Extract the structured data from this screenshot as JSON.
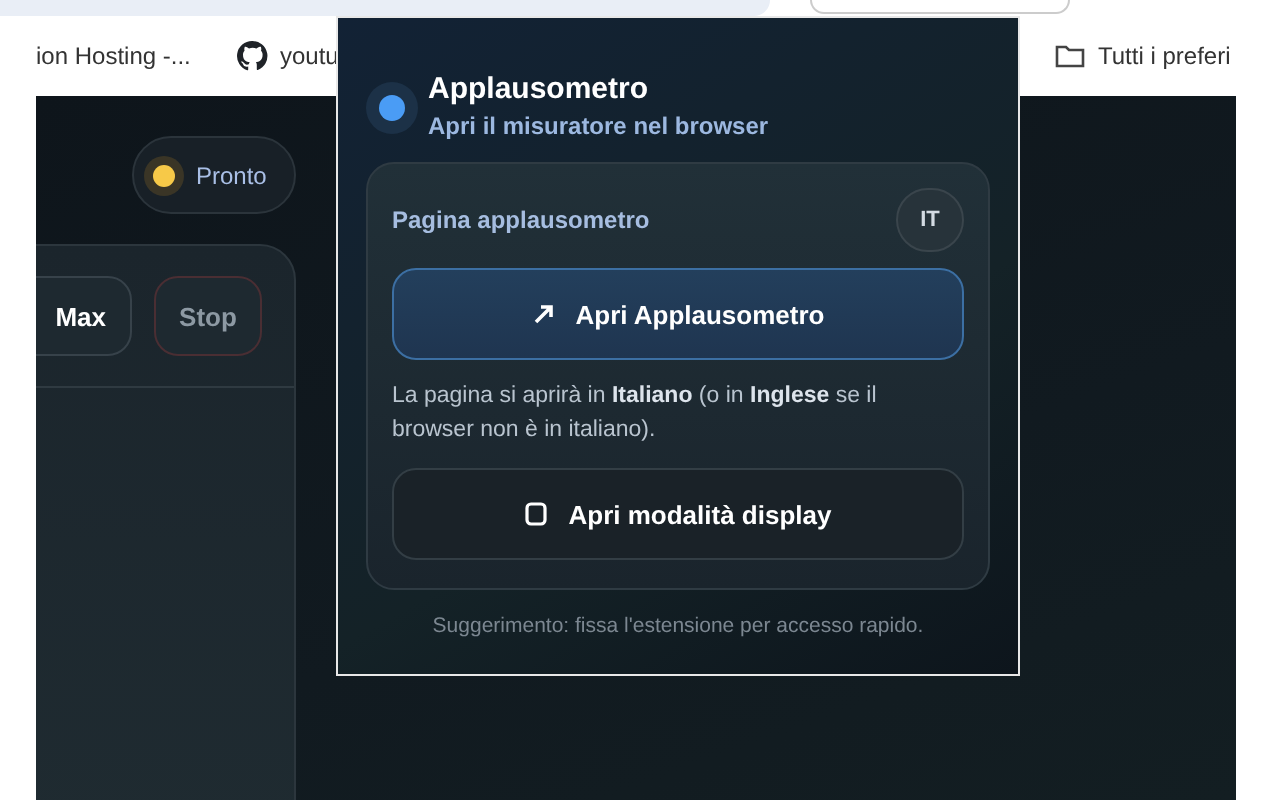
{
  "bookmarks": [
    {
      "label": "ion Hosting -...",
      "kind": "plain"
    },
    {
      "label": "youtu",
      "kind": "repo"
    },
    {
      "label": "Tutti i preferi",
      "kind": "folder"
    }
  ],
  "status": {
    "label": "Pronto"
  },
  "controls": [
    {
      "label": "Max",
      "kind": "default"
    },
    {
      "label": "Stop",
      "kind": "danger"
    }
  ],
  "popup": {
    "title": "Applausometro",
    "subtitle": "Apri il misuratore nel browser",
    "card": {
      "heading": "Pagina applausometro",
      "badge": "IT",
      "buttons": [
        {
          "label": "Apri Applausometro",
          "kind": "primary"
        },
        {
          "label": "Apri modalità display",
          "kind": "display"
        }
      ],
      "note": "La pagina si aprirà in **Italiano** (o in **Inglese** se il browser non è in italiano)."
    },
    "footer": "Suggerimento: fissa l'estensione per accesso rapido."
  }
}
